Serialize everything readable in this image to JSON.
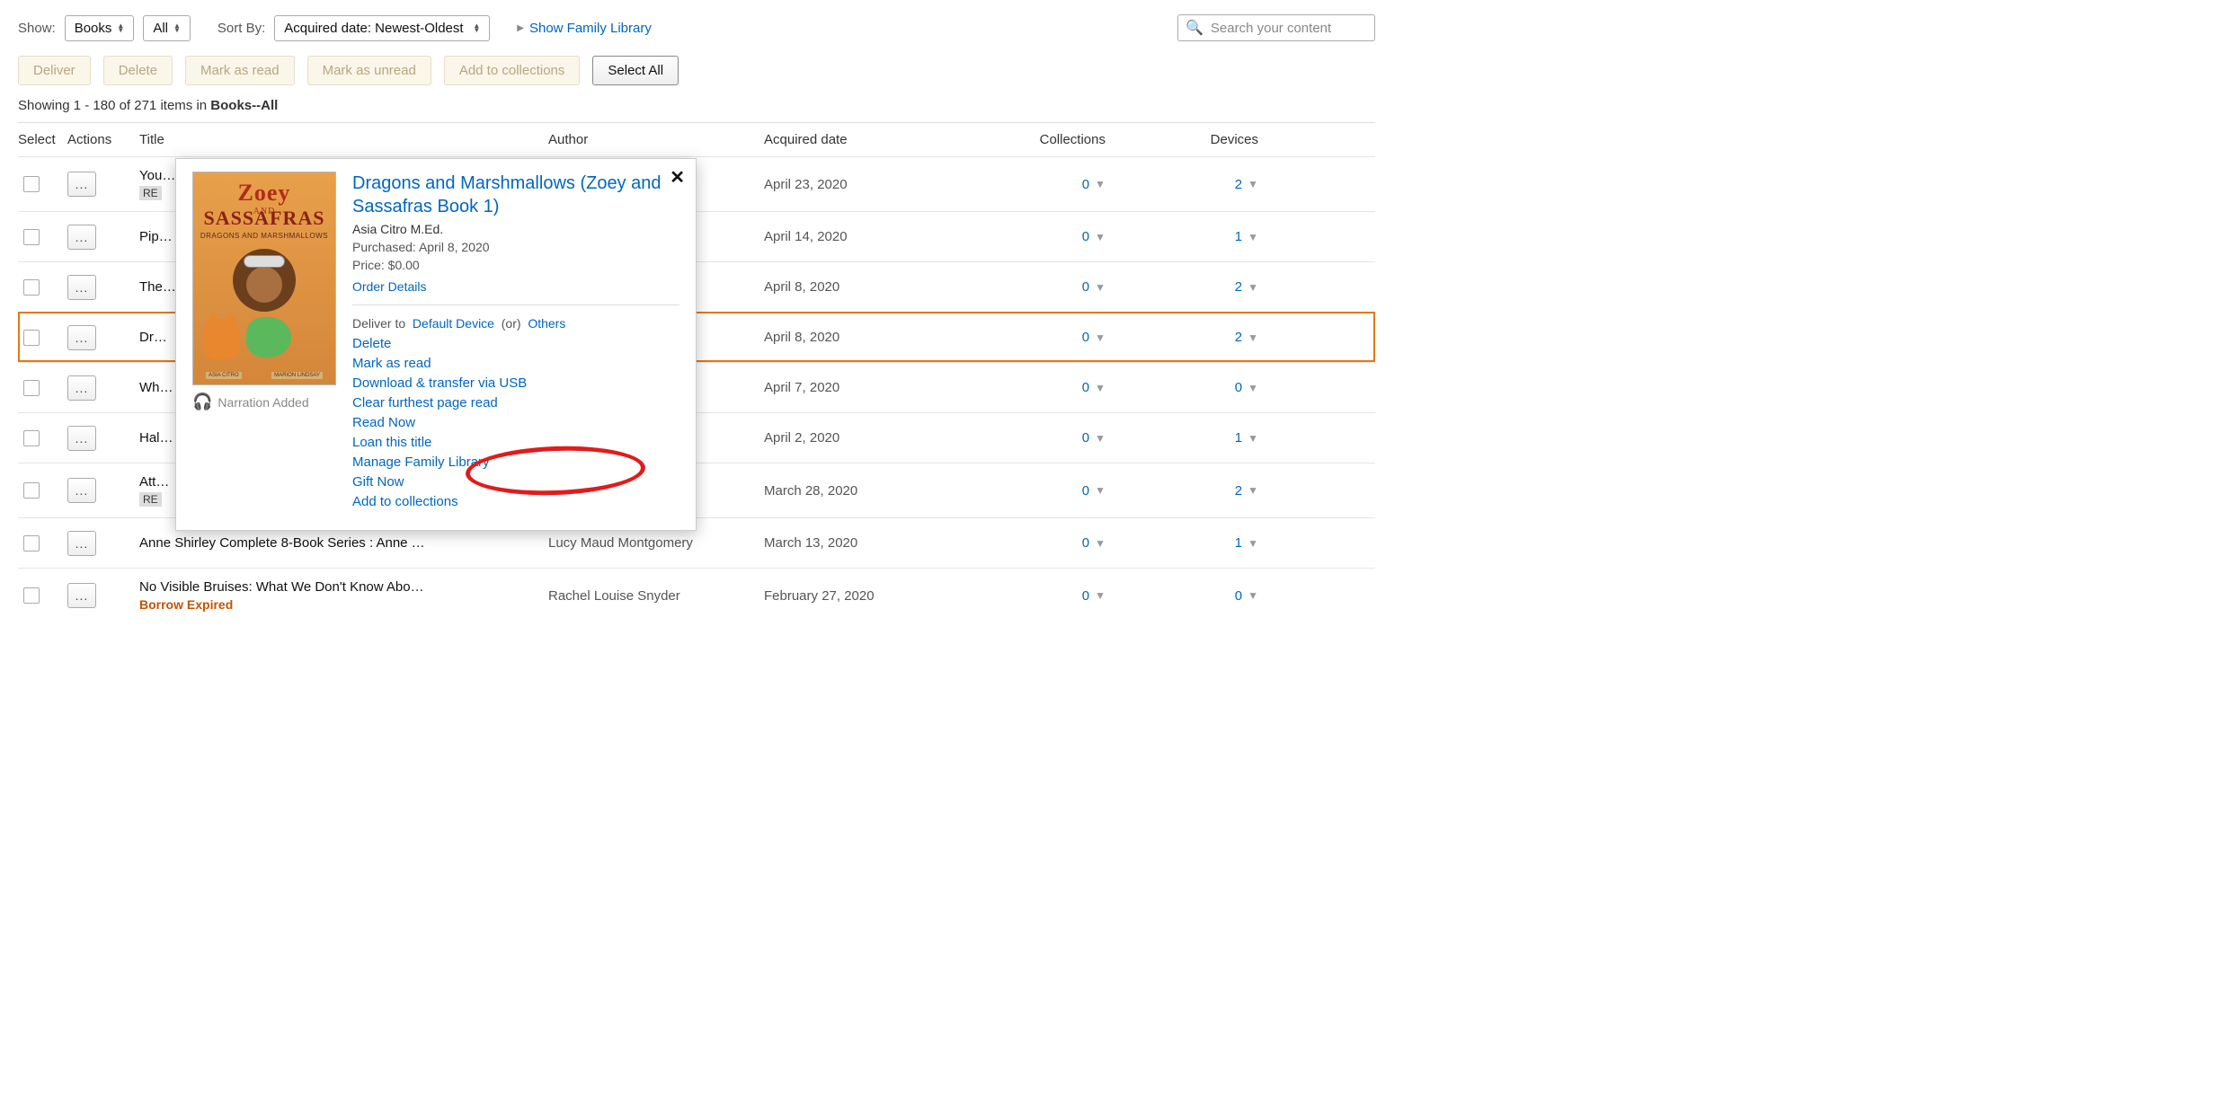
{
  "toolbar1": {
    "show_label": "Show:",
    "show_value": "Books",
    "show_filter": "All",
    "sort_label": "Sort By:",
    "sort_value": "Acquired date: Newest-Oldest",
    "family_link": "Show Family Library",
    "search_placeholder": "Search your content"
  },
  "toolbar2": {
    "deliver": "Deliver",
    "delete": "Delete",
    "mark_read": "Mark as read",
    "mark_unread": "Mark as unread",
    "add_collections": "Add to collections",
    "select_all": "Select All"
  },
  "status": {
    "prefix": "Showing 1 - 180 of 271 items in ",
    "bold": "Books--All"
  },
  "headers": {
    "select": "Select",
    "actions": "Actions",
    "title": "Title",
    "author": "Author",
    "date": "Acquired date",
    "collections": "Collections",
    "devices": "Devices"
  },
  "rows": [
    {
      "title": "You…",
      "badge": "RE",
      "author": "",
      "date": "April 23, 2020",
      "col": "0",
      "dev": "2"
    },
    {
      "title": "Pip…",
      "author": "",
      "date": "April 14, 2020",
      "col": "0",
      "dev": "1"
    },
    {
      "title": "The…",
      "author": "",
      "date": "April 8, 2020",
      "col": "0",
      "dev": "2"
    },
    {
      "title": "Dr…",
      "author": "",
      "date": "April 8, 2020",
      "col": "0",
      "dev": "2",
      "selected": true
    },
    {
      "title": "Wh…",
      "author": "",
      "date": "April 7, 2020",
      "col": "0",
      "dev": "0"
    },
    {
      "title": "Hal…",
      "author": "",
      "date": "April 2, 2020",
      "col": "0",
      "dev": "1"
    },
    {
      "title": "Att…",
      "badge": "RE",
      "author": "",
      "date": "March 28, 2020",
      "col": "0",
      "dev": "2"
    },
    {
      "title": "Anne Shirley Complete 8-Book Series : Anne …",
      "author": "Lucy Maud Montgomery",
      "date": "March 13, 2020",
      "col": "0",
      "dev": "1"
    },
    {
      "title": "No Visible Bruises: What We Don't Know Abo…",
      "author": "Rachel Louise Snyder",
      "date": "February 27, 2020",
      "col": "0",
      "dev": "0",
      "borrow_expired": "Borrow Expired"
    }
  ],
  "popup": {
    "title": "Dragons and Marshmallows (Zoey and Sassafras Book 1)",
    "author": "Asia Citro M.Ed.",
    "purchased": "Purchased: April 8, 2020",
    "price": "Price: $0.00",
    "order_details": "Order Details",
    "narration": "Narration Added",
    "deliver_label": "Deliver to",
    "deliver_default": "Default Device",
    "deliver_or": "(or)",
    "deliver_others": "Others",
    "actions": {
      "delete": "Delete",
      "mark_read": "Mark as read",
      "download_usb": "Download & transfer via USB",
      "clear_page": "Clear furthest page read",
      "read_now": "Read Now",
      "loan": "Loan this title",
      "family": "Manage Family Library",
      "gift": "Gift Now",
      "add_col": "Add to collections"
    },
    "cover": {
      "name1": "Zoey",
      "and": "AND",
      "name2": "SASSAFRAS",
      "sub": "DRAGONS AND MARSHMALLOWS",
      "auth1": "ASIA CITRO",
      "auth2": "MARION LINDSAY"
    }
  }
}
